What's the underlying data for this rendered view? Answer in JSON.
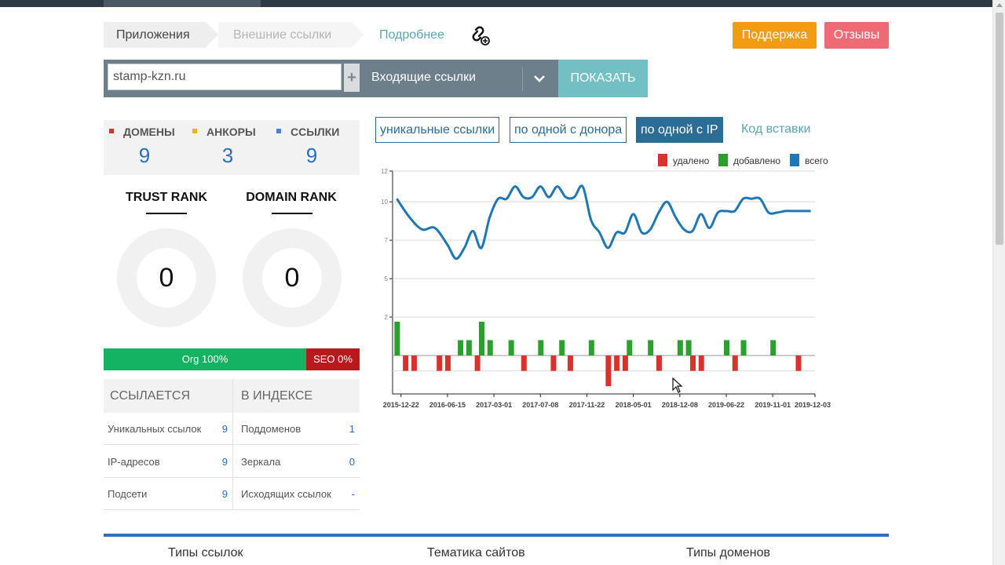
{
  "breadcrumbs": [
    "Приложения",
    "Внешние ссылки"
  ],
  "more_link": "Подробнее",
  "icons": {
    "chain": "link-add-icon",
    "plus": "plus-icon",
    "chevron": "chevron-down-icon",
    "cursor": "mouse-cursor-icon"
  },
  "buttons": {
    "support": "Поддержка",
    "reviews": "Отзывы",
    "show": "ПОКАЗАТЬ"
  },
  "colors": {
    "support": "#f39c12",
    "reviews": "#ee6b76",
    "show": "#72bfc4",
    "accent": "#2c6d96"
  },
  "search": {
    "value": "stamp-kzn.ru",
    "select_value": "Входящие ссылки"
  },
  "stats": [
    {
      "label": "ДОМЕНЫ",
      "value": "9",
      "color": "#d9312b"
    },
    {
      "label": "АНКОРЫ",
      "value": "3",
      "color": "#f0b414"
    },
    {
      "label": "ССЫЛКИ",
      "value": "9",
      "color": "#4a7fd6"
    }
  ],
  "ranks": [
    {
      "title": "TRUST RANK",
      "value": "0"
    },
    {
      "title": "DOMAIN RANK",
      "value": "0"
    }
  ],
  "traffic": {
    "org_label": "Org 100%",
    "seo_label": "SEO 0%",
    "org_fraction": 0.79
  },
  "table": {
    "left_header": "ССЫЛАЕТСЯ",
    "right_header": "В ИНДЕКСЕ",
    "left_rows": [
      {
        "label": "Уникальных ссылок",
        "value": "9"
      },
      {
        "label": "IP-адресов",
        "value": "9"
      },
      {
        "label": "Подсети",
        "value": "9"
      }
    ],
    "right_rows": [
      {
        "label": "Поддоменов",
        "value": "1"
      },
      {
        "label": "Зеркала",
        "value": "0"
      },
      {
        "label": "Исходящих ссылок",
        "value": "-"
      }
    ]
  },
  "tabs": [
    "уникальные ссылки",
    "по одной с донора",
    "по одной с IP"
  ],
  "active_tab": "по одной с IP",
  "code_link": "Код вставки",
  "chart_data": {
    "type": "line",
    "legend": [
      {
        "name": "удалено",
        "color": "#d9312b"
      },
      {
        "name": "добавлено",
        "color": "#2ca02c"
      },
      {
        "name": "всего",
        "color": "#1f77b4"
      }
    ],
    "legend_position": "top-right",
    "grid": true,
    "ylim": [
      -2.5,
      12
    ],
    "y_ticks": [
      "12",
      "10",
      "7",
      "5",
      "2"
    ],
    "y_tick_values": [
      12,
      10,
      7.5,
      5,
      2.5
    ],
    "x_ticks": [
      "2015-12-22",
      "2016-06-15",
      "2017-03-01",
      "2017-07-08",
      "2017-11-22",
      "2018-05-01",
      "2018-12-08",
      "2019-06-22",
      "2019-11-01",
      "2019-12-03"
    ],
    "x_domain": [
      0,
      100
    ],
    "x_tick_positions": [
      2,
      13,
      24,
      35,
      46,
      57,
      68,
      79,
      90,
      100
    ],
    "series": [
      {
        "name": "всего",
        "x": [
          1,
          4,
          7,
          10,
          13,
          15,
          17,
          19,
          21,
          23,
          25,
          27,
          29,
          31,
          33,
          35,
          37,
          39,
          41,
          43,
          45,
          47,
          49,
          51,
          53,
          55,
          57,
          59,
          61,
          63,
          65,
          67,
          69,
          71,
          73,
          75,
          77,
          79,
          81,
          83,
          85,
          87,
          89,
          91,
          93,
          95,
          97,
          99
        ],
        "y": [
          10.2,
          9.0,
          8.2,
          8.3,
          7.2,
          6.3,
          7.0,
          8.1,
          7.0,
          9.0,
          10.2,
          10.2,
          11.0,
          10.3,
          10.3,
          11.0,
          10.3,
          11.0,
          10.3,
          10.3,
          11.0,
          8.8,
          8.0,
          7.0,
          8.0,
          8.0,
          9.2,
          8.0,
          8.2,
          9.3,
          10.0,
          9.0,
          8.2,
          8.1,
          9.2,
          8.3,
          9.3,
          9.4,
          9.4,
          10.2,
          10.2,
          10.2,
          9.3,
          9.3,
          9.4,
          9.4,
          9.4,
          9.4
        ]
      },
      {
        "name": "добавлено",
        "x": [
          1,
          16,
          18,
          21,
          23,
          28,
          35,
          40,
          47,
          56,
          61,
          68,
          70,
          79,
          83,
          90
        ],
        "y": [
          2.2,
          1.0,
          1.0,
          2.2,
          1.0,
          1.0,
          1.0,
          1.0,
          1.0,
          1.0,
          1.0,
          1.0,
          1.0,
          1.0,
          1.0,
          1.0
        ]
      },
      {
        "name": "удалено",
        "x": [
          3,
          5,
          11,
          13,
          20,
          31,
          38,
          42,
          51,
          53,
          55,
          63,
          71,
          73,
          81,
          96
        ],
        "y": [
          -1.0,
          -1.0,
          -1.0,
          -1.0,
          -1.0,
          -1.0,
          -1.0,
          -1.0,
          -2.0,
          -1.0,
          -1.0,
          -1.0,
          -1.0,
          -1.0,
          -1.0,
          -1.0
        ]
      }
    ]
  },
  "bottom_tabs": [
    "Типы ссылок",
    "Тематика сайтов",
    "Типы доменов"
  ]
}
